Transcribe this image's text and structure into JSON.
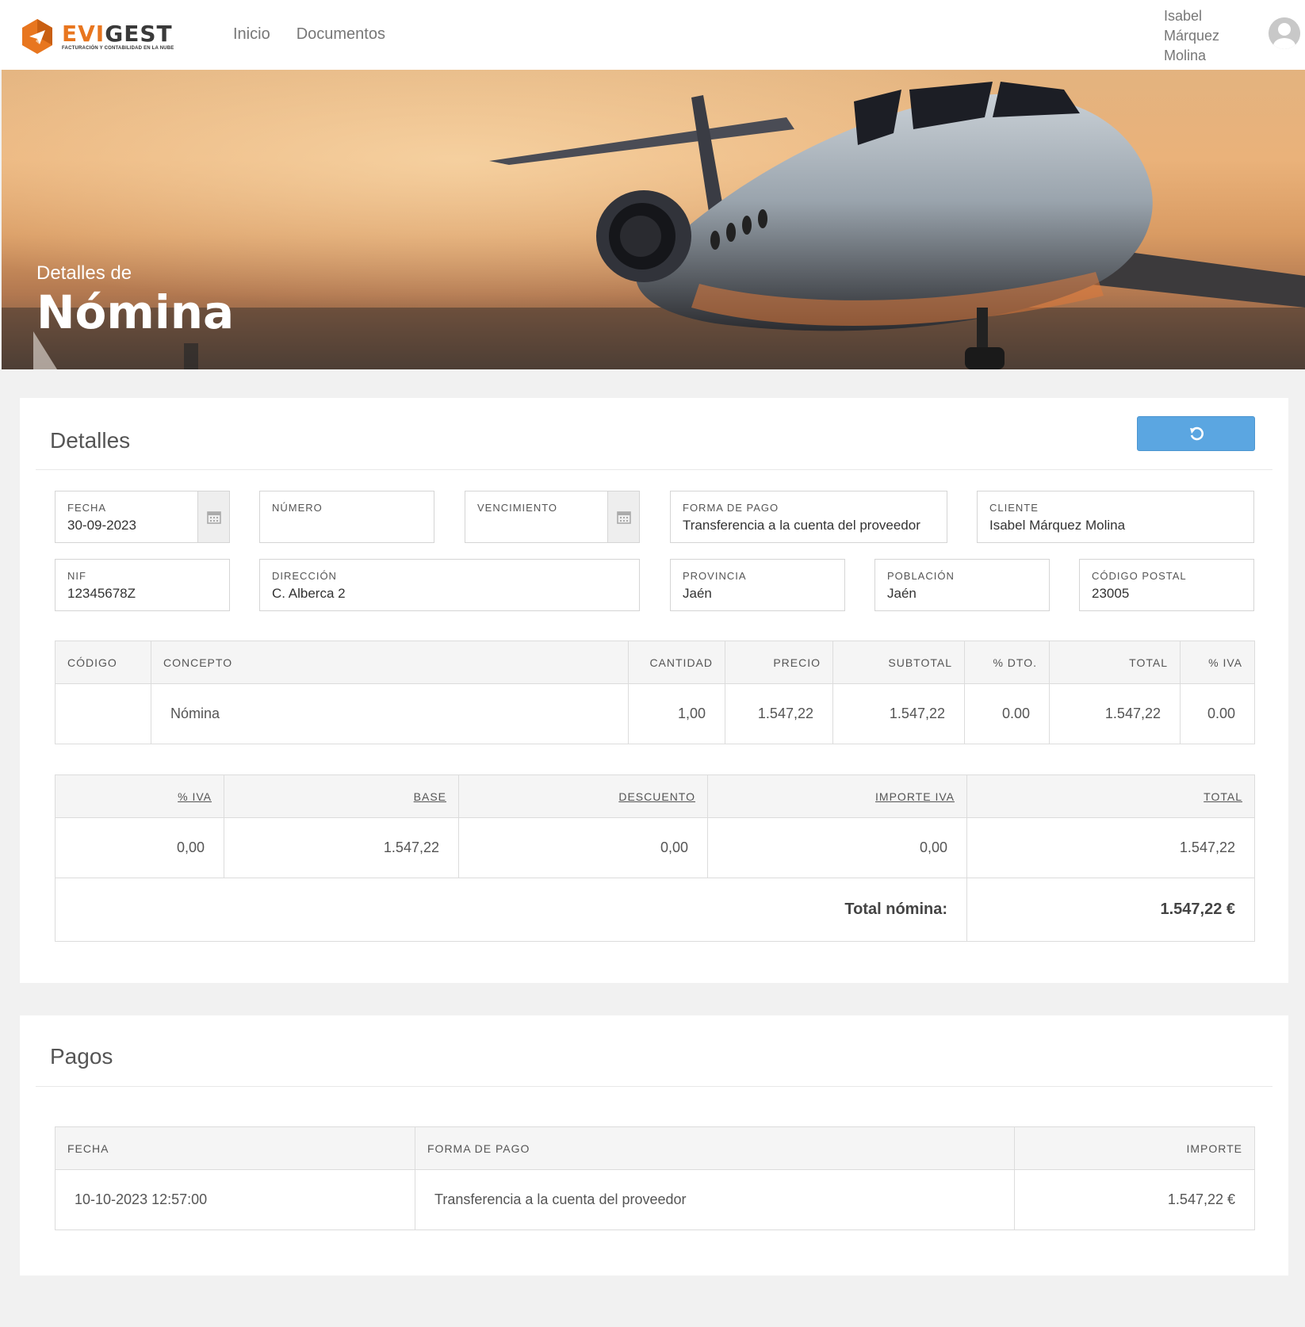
{
  "brand": {
    "name_part1": "EVI",
    "name_part2": "GEST",
    "tagline": "FACTURACIÓN Y CONTABILIDAD EN LA NUBE"
  },
  "nav": {
    "items": [
      "Inicio",
      "Documentos"
    ]
  },
  "user": {
    "line1": "Isabel",
    "line2": "Márquez",
    "line3": "Molina"
  },
  "hero": {
    "subtitle": "Detalles de",
    "title": "Nómina"
  },
  "details": {
    "title": "Detalles",
    "fields": {
      "fecha": {
        "label": "FECHA",
        "value": "30-09-2023"
      },
      "numero": {
        "label": "NÚMERO",
        "value": ""
      },
      "vencimiento": {
        "label": "VENCIMIENTO",
        "value": ""
      },
      "forma_pago": {
        "label": "FORMA DE PAGO",
        "value": "Transferencia a la cuenta del proveedor"
      },
      "cliente": {
        "label": "CLIENTE",
        "value": "Isabel Márquez Molina"
      },
      "nif": {
        "label": "NIF",
        "value": "12345678Z"
      },
      "direccion": {
        "label": "DIRECCIÓN",
        "value": "C. Alberca 2"
      },
      "provincia": {
        "label": "PROVINCIA",
        "value": "Jaén"
      },
      "poblacion": {
        "label": "POBLACIÓN",
        "value": "Jaén"
      },
      "codigo_postal": {
        "label": "CÓDIGO POSTAL",
        "value": "23005"
      }
    },
    "lines": {
      "headers": [
        "CÓDIGO",
        "CONCEPTO",
        "CANTIDAD",
        "PRECIO",
        "SUBTOTAL",
        "% DTO.",
        "TOTAL",
        "% IVA"
      ],
      "rows": [
        [
          "",
          "Nómina",
          "1,00",
          "1.547,22",
          "1.547,22",
          "0.00",
          "1.547,22",
          "0.00"
        ]
      ]
    },
    "taxes": {
      "headers": [
        "% IVA",
        "BASE",
        "DESCUENTO",
        "IMPORTE IVA",
        "TOTAL"
      ],
      "rows": [
        [
          "0,00",
          "1.547,22",
          "0,00",
          "0,00",
          "1.547,22"
        ]
      ],
      "total_label": "Total nómina:",
      "total_value": "1.547,22 €"
    }
  },
  "payments": {
    "title": "Pagos",
    "headers": [
      "FECHA",
      "FORMA DE PAGO",
      "IMPORTE"
    ],
    "rows": [
      [
        "10-10-2023 12:57:00",
        "Transferencia a la cuenta del proveedor",
        "1.547,22 €"
      ]
    ]
  },
  "colors": {
    "accent": "#5ba6e1",
    "brand_orange": "#e8761f"
  },
  "icons": {
    "refresh": "refresh-icon",
    "calendar": "calendar-icon",
    "avatar": "user-avatar-icon"
  }
}
